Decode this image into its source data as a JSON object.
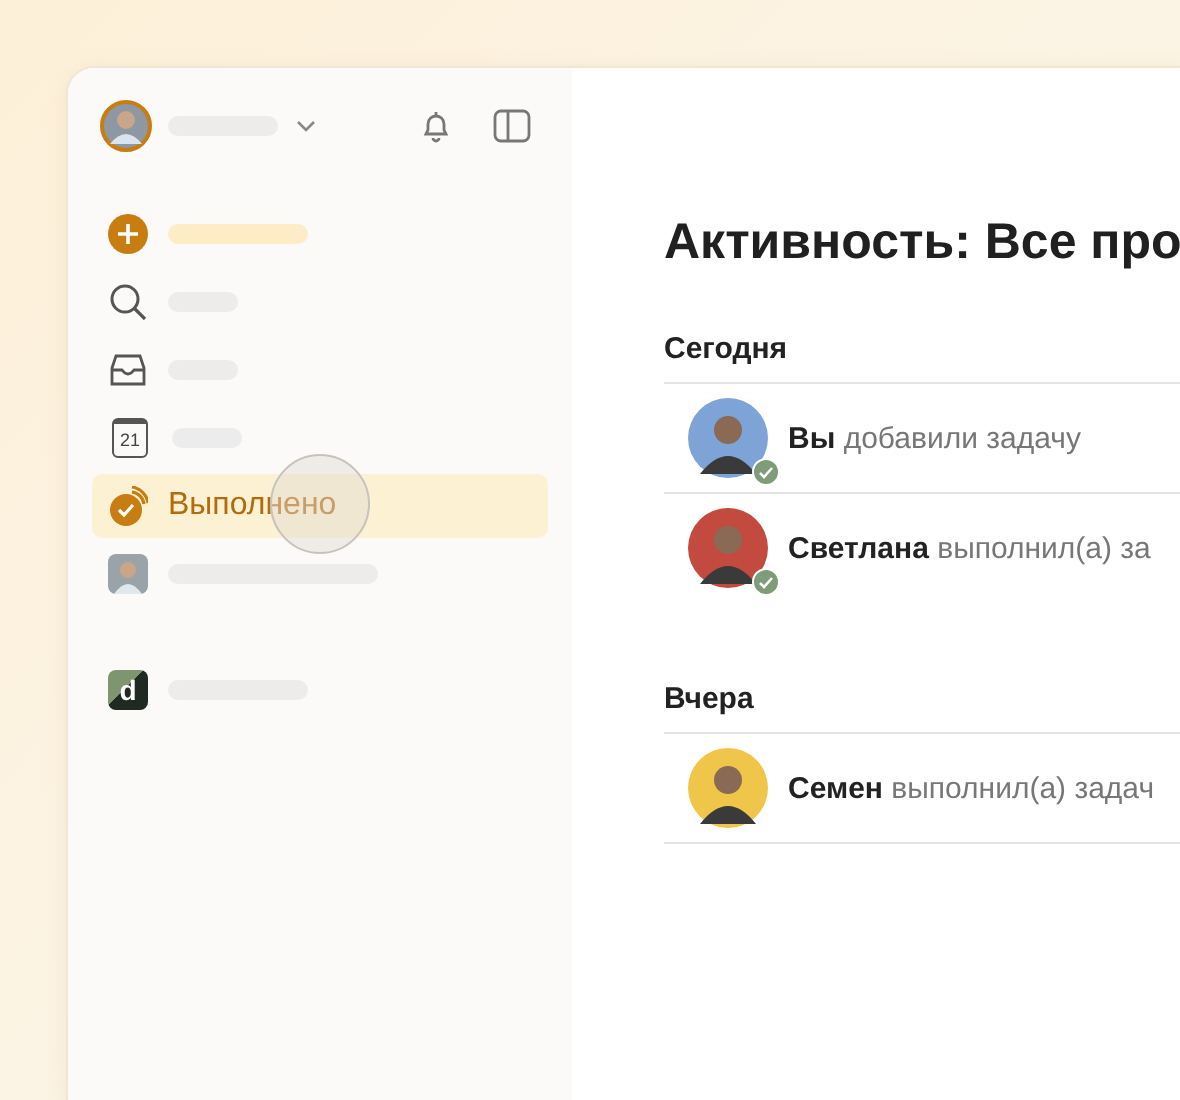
{
  "sidebar": {
    "items": [
      {
        "kind": "add",
        "selected": false
      },
      {
        "kind": "search",
        "selected": false
      },
      {
        "kind": "inbox",
        "selected": false
      },
      {
        "kind": "calendar",
        "day": "21",
        "selected": false
      },
      {
        "kind": "done",
        "label": "Выполнено",
        "selected": true
      }
    ],
    "projects": [
      {
        "kind": "photo"
      },
      {
        "kind": "logo",
        "logo_letter": "d"
      }
    ]
  },
  "main": {
    "title": "Активность: Все про",
    "sections": [
      {
        "heading": "Сегодня",
        "events": [
          {
            "actor": "Вы",
            "action": "добавили задачу",
            "color": "#7ea3d6",
            "checked": true
          },
          {
            "actor": "Светлана",
            "action": "выполнил(а) за",
            "color": "#c24a3f",
            "checked": true
          }
        ]
      },
      {
        "heading": "Вчера",
        "events": [
          {
            "actor": "Семен",
            "action": "выполнил(а) задач",
            "color": "#f0c64a",
            "checked": false
          }
        ]
      }
    ]
  }
}
